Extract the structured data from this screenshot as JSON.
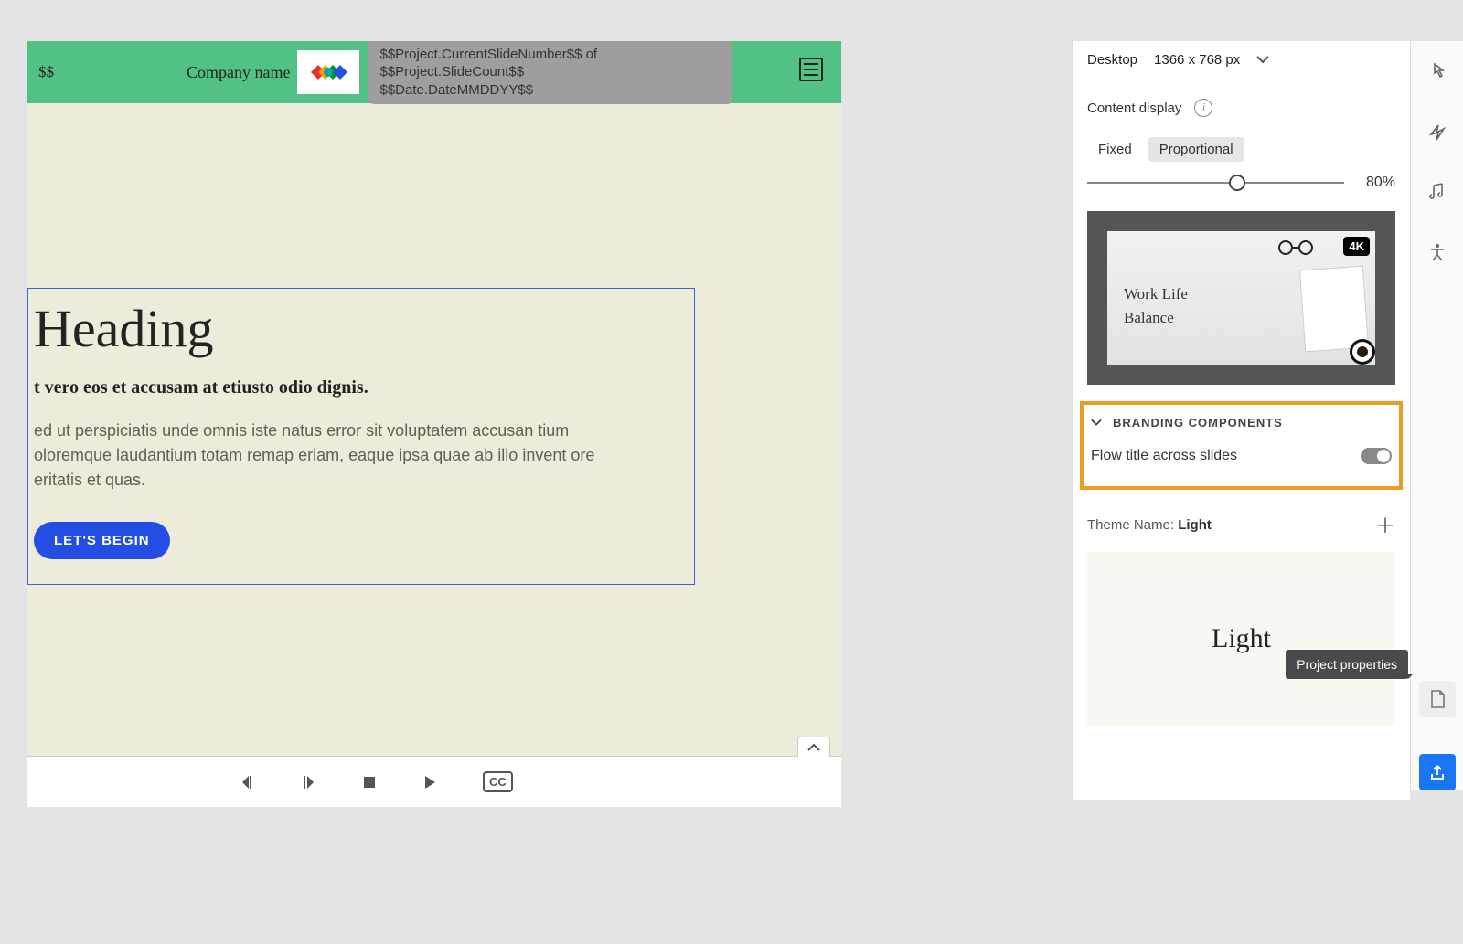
{
  "canvas": {
    "topLeftVar": "$$",
    "companyLabel": "Company name",
    "metaLine1": "$$Project.CurrentSlideNumber$$ of $$Project.SlideCount$$",
    "metaLine2": "$$Date.DateMMDDYY$$",
    "heading": "Heading",
    "subhead": "t vero eos et accusam at etiusto odio dignis.",
    "body": "ed ut perspiciatis unde omnis iste natus error sit voluptatem accusan tium oloremque laudantium totam remap eriam, eaque ipsa quae ab illo invent ore eritatis et quas.",
    "cta": "LET'S BEGIN"
  },
  "playbar": {
    "cc": "CC"
  },
  "props": {
    "deviceLabel": "Desktop",
    "deviceSize": "1366 x 768 px",
    "contentDisplayLabel": "Content display",
    "segFixed": "Fixed",
    "segProportional": "Proportional",
    "sliderValue": "80%",
    "previewText": "Work Life\nBalance",
    "resBadge": "4K",
    "brandingHeader": "BRANDING COMPONENTS",
    "flowTitleLabel": "Flow title across slides",
    "themeLabel": "Theme Name:",
    "themeName": "Light",
    "themeSwatch": "Light"
  },
  "tooltip": "Project properties"
}
